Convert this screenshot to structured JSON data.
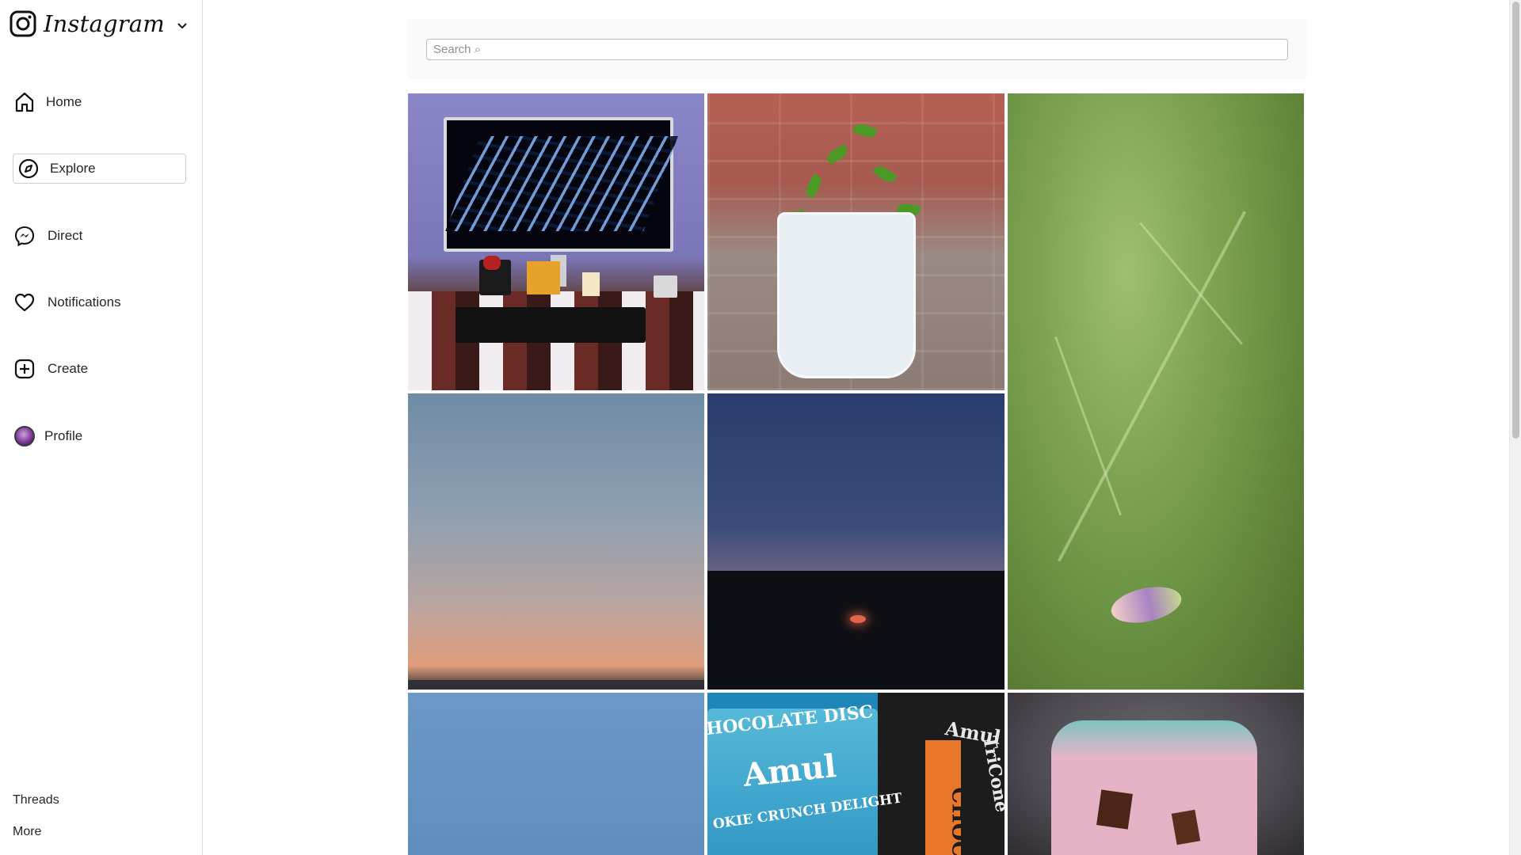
{
  "brand": {
    "wordmark": "Instagram"
  },
  "nav": [
    {
      "id": "home",
      "label": "Home",
      "icon": "home-icon"
    },
    {
      "id": "explore",
      "label": "Explore",
      "icon": "compass-icon",
      "active": true
    },
    {
      "id": "direct",
      "label": "Direct",
      "icon": "messenger-icon"
    },
    {
      "id": "notifications",
      "label": "Notifications",
      "icon": "heart-icon"
    },
    {
      "id": "create",
      "label": "Create",
      "icon": "plus-square-icon"
    },
    {
      "id": "profile",
      "label": "Profile",
      "icon": "avatar"
    }
  ],
  "bottom_links": {
    "threads": "Threads",
    "more": "More"
  },
  "search": {
    "placeholder": "Search ⌕"
  },
  "grid": {
    "tiles": [
      {
        "subject": "desk-setup"
      },
      {
        "subject": "potted-plant"
      },
      {
        "subject": "leaf-closeup"
      },
      {
        "subject": "dusk-sky"
      },
      {
        "subject": "sunset-trees"
      },
      {
        "subject": "blue-sky"
      },
      {
        "subject": "amul-ice-cream"
      },
      {
        "subject": "ice-cream-cup"
      }
    ],
    "amul_text": {
      "line1": "HOCOLATE DISC",
      "line2": "Amul",
      "line3": "OKIE CRUNCH DELIGHT",
      "line4": "Amul",
      "line5": "TriCone",
      "line6": "CHOCO"
    }
  },
  "colors": {
    "border": "#dbdbdb",
    "text": "#262626",
    "placeholder": "#8e8e8e"
  }
}
